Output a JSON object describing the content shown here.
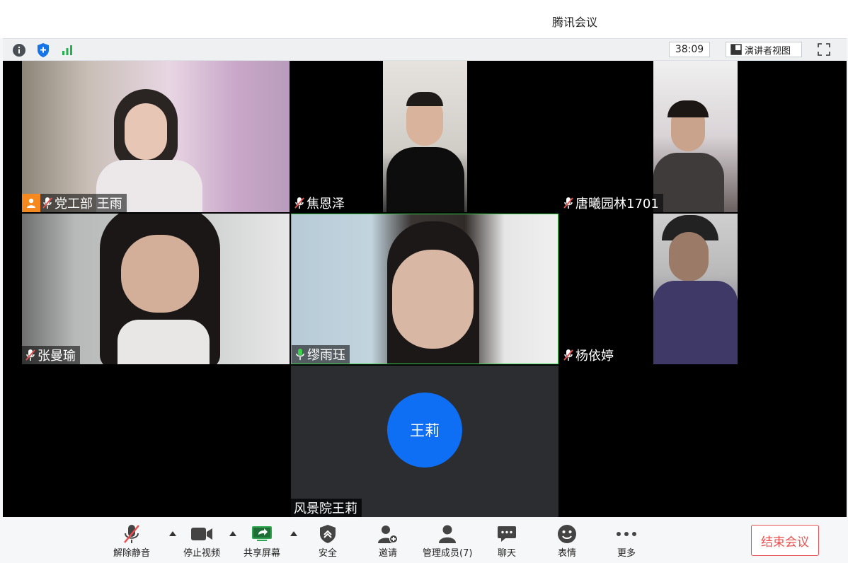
{
  "window": {
    "title": "腾讯会议"
  },
  "topbar": {
    "timer": "38:09",
    "presenter_view_label": "演讲者视图"
  },
  "participants": [
    {
      "name": "党工部 王雨",
      "muted": true
    },
    {
      "name": "焦恩泽",
      "muted": true
    },
    {
      "name": "唐曦园林1701",
      "muted": true
    },
    {
      "name": "张曼瑜",
      "muted": true
    },
    {
      "name": "缪雨珏",
      "muted": false,
      "speaking": true
    },
    {
      "name": "杨依婷",
      "muted": true
    },
    {
      "name": "风景院王莉",
      "avatar_text": "王莉"
    }
  ],
  "toolbar": {
    "unmute": "解除静音",
    "stop_video": "停止视频",
    "share_screen": "共享屏幕",
    "security": "安全",
    "invite": "邀请",
    "manage_members": "管理成员(7)",
    "chat": "聊天",
    "reactions": "表情",
    "more": "更多",
    "end_meeting": "结束会议"
  },
  "colors": {
    "accent": "#0e6ff4",
    "speaking": "#3bd14b",
    "end": "#e8514f",
    "host_badge": "#f5891f"
  }
}
